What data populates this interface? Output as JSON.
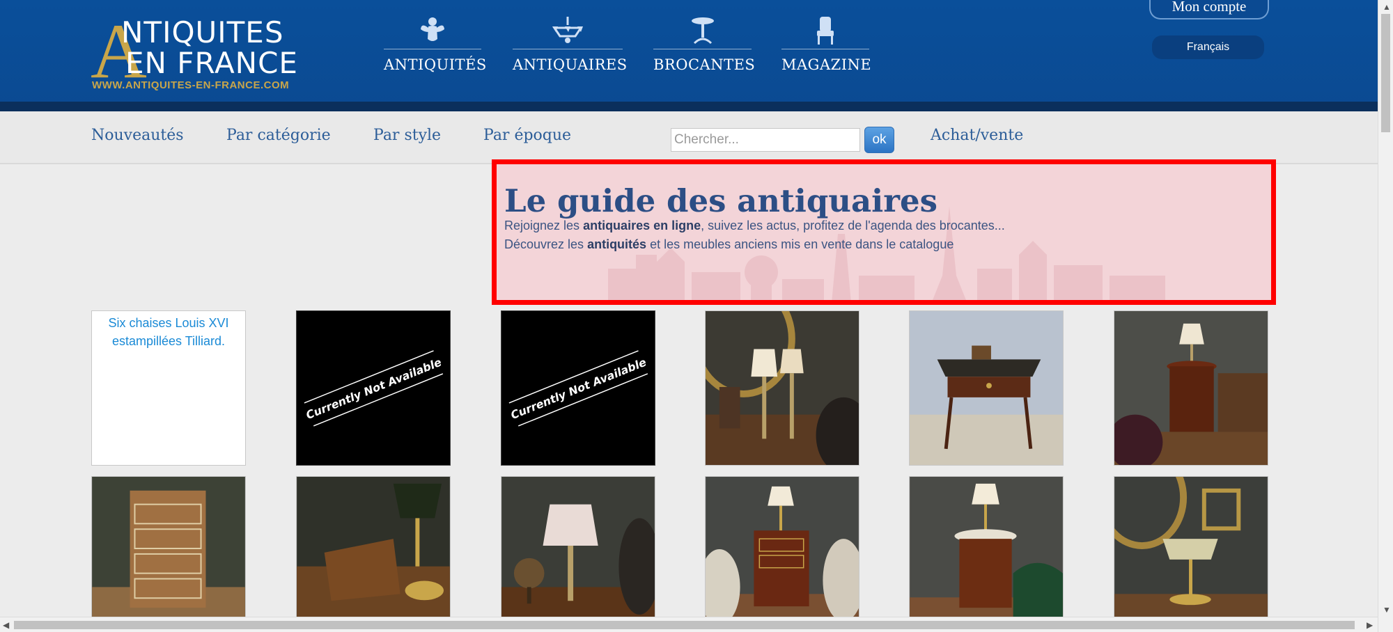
{
  "header": {
    "logo": {
      "big_letter": "A",
      "line1": "NTIQUITES",
      "line2": "EN FRANCE",
      "url": "WWW.ANTIQUITES-EN-FRANCE.COM"
    },
    "nav": [
      {
        "label": "ANTIQUITÉS",
        "icon": "cherub-icon"
      },
      {
        "label": "ANTIQUAIRES",
        "icon": "chandelier-icon"
      },
      {
        "label": "BROCANTES",
        "icon": "pedestal-table-icon"
      },
      {
        "label": "MAGAZINE",
        "icon": "armchair-icon"
      }
    ],
    "account_label": "Mon compte",
    "language_label": "Français"
  },
  "subnav": {
    "links": [
      "Nouveautés",
      "Par catégorie",
      "Par style",
      "Par époque"
    ],
    "search_placeholder": "Chercher...",
    "search_button": "ok",
    "achat_label": "Achat/vente"
  },
  "intro": {
    "title": "Le guide des antiquaires",
    "line1": {
      "before": "Rejoignez les ",
      "bold": "antiquaires en ligne",
      "after": ", suivez les actus, profitez de l'agenda des brocantes..."
    },
    "line2": {
      "before": "Découvrez les ",
      "bold": "antiquités",
      "after": " et les meubles anciens mis en vente dans le catalogue"
    }
  },
  "gallery": {
    "row1": [
      {
        "kind": "broken",
        "alt": "Six chaises Louis XVI estampillées Tilliard."
      },
      {
        "kind": "not-available",
        "text": "Currently Not Available"
      },
      {
        "kind": "not-available",
        "text": "Currently Not Available"
      },
      {
        "kind": "photo",
        "subject": "two table lamps with oval mirror"
      },
      {
        "kind": "photo",
        "subject": "writing desk with leather top"
      },
      {
        "kind": "photo",
        "subject": "round side table with lamp"
      }
    ],
    "row2": [
      {
        "kind": "photo",
        "subject": "chest of drawers"
      },
      {
        "kind": "photo",
        "subject": "reading stand with tole lamp"
      },
      {
        "kind": "photo",
        "subject": "lamp with shade and globe"
      },
      {
        "kind": "photo",
        "subject": "mahogany bedside table with lamp"
      },
      {
        "kind": "photo",
        "subject": "round marble-top table with lamp"
      },
      {
        "kind": "photo",
        "subject": "bouillotte lamp with mirror"
      }
    ]
  },
  "colors": {
    "header_blue": "#0b4a92",
    "gold": "#c9a64a",
    "link_blue": "#2c5d98",
    "highlight_border": "#ff0000"
  }
}
